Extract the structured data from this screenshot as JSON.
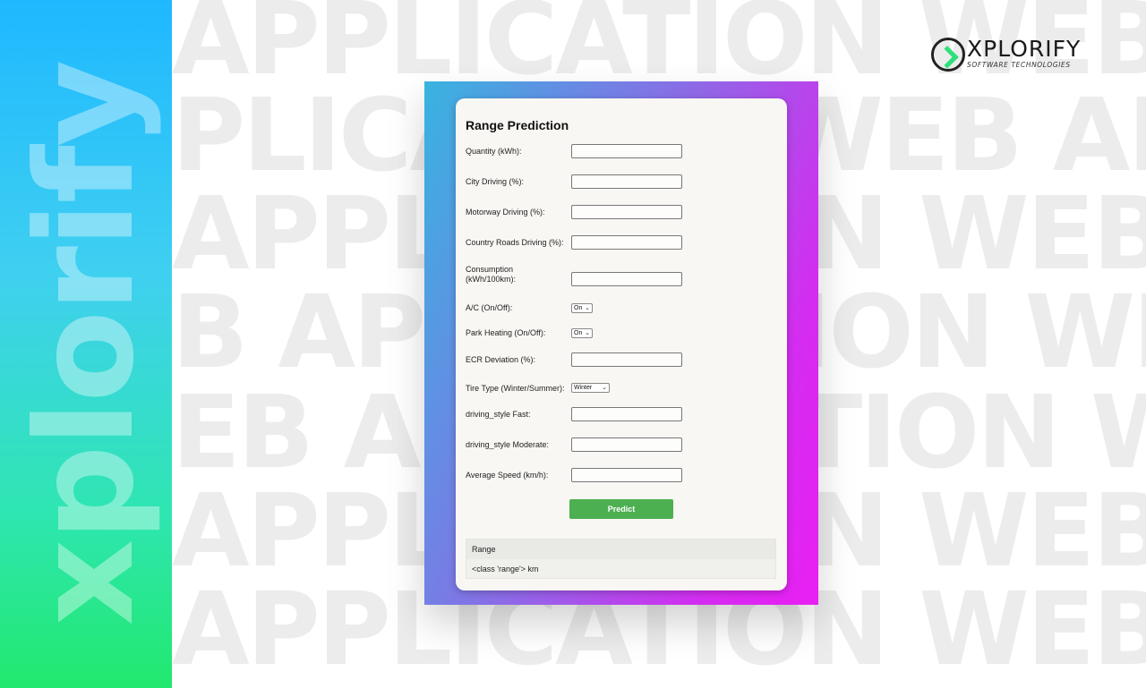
{
  "branding": {
    "side_text": "xplorify",
    "bg_words": [
      "APPLICATION WEB A",
      "PLICATION WEB AP",
      "APPLICATION WEB A",
      "B APPLICATION WEB",
      "EB APPLICATION WE",
      "APPLICATION WEB AP",
      "APPLICATION WEB"
    ],
    "logo_name": "XPLORIFY",
    "logo_tagline": "SOFTWARE TECHNOLOGIES",
    "accent_green": "#2ce07a"
  },
  "form": {
    "title": "Range Prediction",
    "fields": [
      {
        "label": "Quantity (kWh):",
        "type": "text",
        "value": ""
      },
      {
        "label": "City Driving (%):",
        "type": "text",
        "value": ""
      },
      {
        "label": "Motorway Driving (%):",
        "type": "text",
        "value": ""
      },
      {
        "label": "Country Roads Driving (%):",
        "type": "text",
        "value": ""
      },
      {
        "label": "Consumption (kWh/100km):",
        "type": "text",
        "value": ""
      },
      {
        "label": "A/C (On/Off):",
        "type": "select",
        "value": "On"
      },
      {
        "label": "Park Heating (On/Off):",
        "type": "select",
        "value": "On"
      },
      {
        "label": "ECR Deviation (%):",
        "type": "text",
        "value": ""
      },
      {
        "label": "Tire Type (Winter/Summer):",
        "type": "select",
        "value": "Winter"
      },
      {
        "label": "driving_style Fast:",
        "type": "text",
        "value": ""
      },
      {
        "label": "driving_style Moderate:",
        "type": "text",
        "value": ""
      },
      {
        "label": "Average Speed (km/h):",
        "type": "text",
        "value": ""
      }
    ],
    "predict_label": "Predict",
    "button_color": "#4caf50"
  },
  "result": {
    "heading": "Range",
    "value": "<class 'range'> km"
  }
}
